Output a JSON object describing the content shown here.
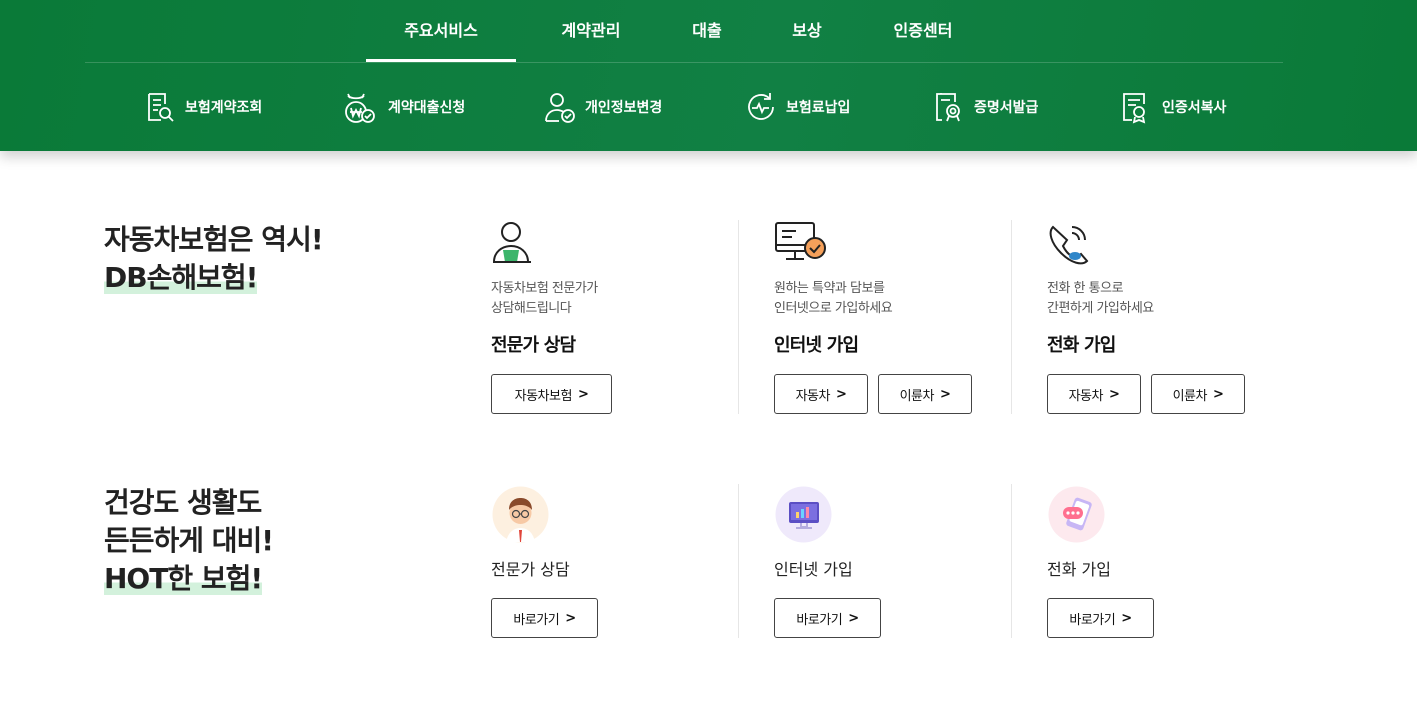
{
  "top_nav": [
    "주요서비스",
    "계약관리",
    "대출",
    "보상",
    "인증센터"
  ],
  "sub_nav": [
    "보험계약조회",
    "계약대출신청",
    "개인정보변경",
    "보험료납입",
    "증명서발급",
    "인증서복사"
  ],
  "section1": {
    "title_line1": "자동차보험은 역시!",
    "title_line2": "DB손해보험!",
    "cards": [
      {
        "desc1": "자동차보험 전문가가",
        "desc2": "상담해드립니다",
        "title": "전문가 상담",
        "buttons": [
          "자동차보험"
        ]
      },
      {
        "desc1": "원하는 특약과 담보를",
        "desc2": "인터넷으로 가입하세요",
        "title": "인터넷 가입",
        "buttons": [
          "자동차",
          "이륜차"
        ]
      },
      {
        "desc1": "전화 한 통으로",
        "desc2": "간편하게 가입하세요",
        "title": "전화 가입",
        "buttons": [
          "자동차",
          "이륜차"
        ]
      }
    ]
  },
  "section2": {
    "title_line1": "건강도 생활도",
    "title_line2": "든든하게 대비!",
    "title_line3": "HOT한 보험!",
    "cards": [
      {
        "title": "전문가 상담",
        "button": "바로가기"
      },
      {
        "title": "인터넷 가입",
        "button": "바로가기"
      },
      {
        "title": "전화 가입",
        "button": "바로가기"
      }
    ]
  },
  "icons": {
    "sub_nav": [
      "document-search-icon",
      "loan-money-check-icon",
      "person-check-icon",
      "premium-payment-icon",
      "certificate-icon",
      "certificate-copy-icon"
    ],
    "section1": [
      "consultant-person-icon",
      "computer-check-icon",
      "phone-call-icon"
    ],
    "section2": [
      "consultant-avatar-icon",
      "monitor-chart-icon",
      "phone-chat-icon"
    ]
  },
  "colors": {
    "header_green": "#0a7a38",
    "highlight": "#d3f1dc",
    "accent_green": "#3cb56b",
    "accent_orange": "#f5a05a"
  }
}
